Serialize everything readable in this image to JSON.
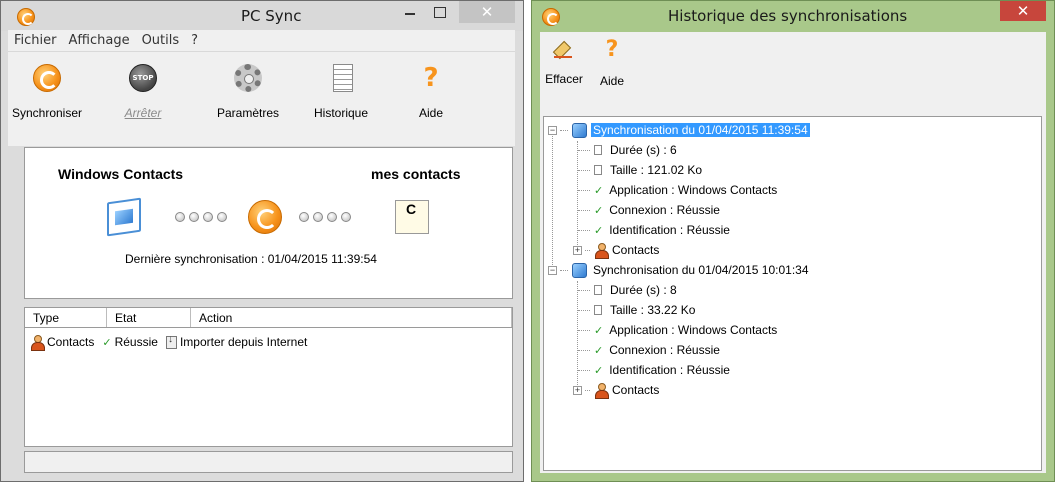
{
  "pcsync": {
    "title": "PC Sync",
    "menu": [
      "Fichier",
      "Affichage",
      "Outils",
      "?"
    ],
    "toolbar": {
      "sync": "Synchroniser",
      "stop": "Arrêter",
      "settings": "Paramètres",
      "history": "Historique",
      "help": "Aide"
    },
    "source": "Windows Contacts",
    "target": "mes contacts",
    "last_sync": "Dernière synchronisation : 01/04/2015 11:39:54",
    "table": {
      "headers": [
        "Type",
        "Etat",
        "Action"
      ],
      "rows": [
        {
          "type": "Contacts",
          "state": "Réussie",
          "action": "Importer depuis Internet"
        }
      ]
    }
  },
  "history": {
    "title": "Historique des synchronisations",
    "toolbar": {
      "clear": "Effacer",
      "help": "Aide"
    },
    "entries": [
      {
        "label": "Synchronisation du 01/04/2015 11:39:54",
        "duration": "Durée (s) : 6",
        "size": "Taille : 121.02 Ko",
        "application": "Application : Windows Contacts",
        "connection": "Connexion : Réussie",
        "identification": "Identification : Réussie",
        "contacts": "Contacts"
      },
      {
        "label": "Synchronisation du 01/04/2015 10:01:34",
        "duration": "Durée (s) : 8",
        "size": "Taille :  33.22 Ko",
        "application": "Application : Windows Contacts",
        "connection": "Connexion : Réussie",
        "identification": "Identification : Réussie",
        "contacts": "Contacts"
      }
    ]
  },
  "colors": {
    "history_frame": "#a9c88a",
    "close_red": "#c7463c",
    "selection": "#3399ff",
    "accent_orange": "#f7941d"
  }
}
